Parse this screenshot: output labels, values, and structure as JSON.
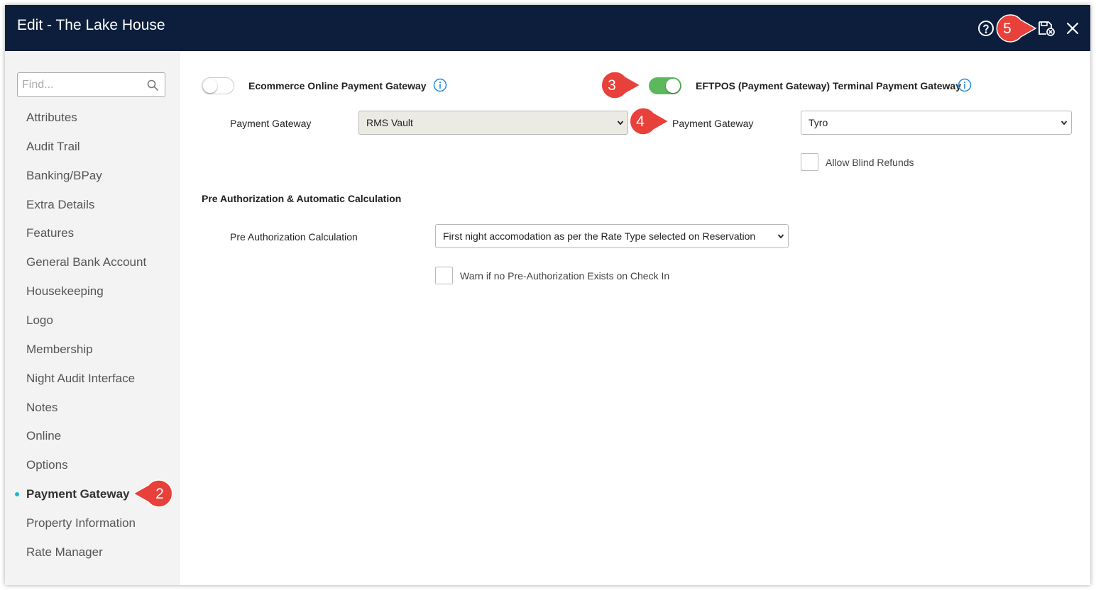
{
  "window": {
    "title": "Edit - The Lake House"
  },
  "header_icons": {
    "help": "help-icon",
    "save_close": "save-close-icon",
    "close": "close-icon"
  },
  "sidebar": {
    "search_placeholder": "Find...",
    "items": [
      {
        "label": "Attributes"
      },
      {
        "label": "Audit Trail"
      },
      {
        "label": "Banking/BPay"
      },
      {
        "label": "Extra Details"
      },
      {
        "label": "Features"
      },
      {
        "label": "General Bank Account"
      },
      {
        "label": "Housekeeping"
      },
      {
        "label": "Logo"
      },
      {
        "label": "Membership"
      },
      {
        "label": "Night Audit Interface"
      },
      {
        "label": "Notes"
      },
      {
        "label": "Online"
      },
      {
        "label": "Options"
      },
      {
        "label": "Payment Gateway"
      },
      {
        "label": "Property Information"
      },
      {
        "label": "Rate Manager"
      }
    ],
    "active_index": 13
  },
  "main": {
    "ecommerce": {
      "label": "Ecommerce Online Payment Gateway",
      "enabled": false,
      "gateway_label": "Payment Gateway",
      "gateway_value": "RMS Vault"
    },
    "eftpos": {
      "label": "EFTPOS (Payment Gateway) Terminal Payment Gateway",
      "enabled": true,
      "gateway_label": "Payment Gateway",
      "gateway_value": "Tyro",
      "blind_refunds_label": "Allow Blind Refunds",
      "blind_refunds_checked": false
    },
    "preauth": {
      "section_title": "Pre Authorization & Automatic Calculation",
      "calc_label": "Pre Authorization Calculation",
      "calc_value": "First night accomodation as per the Rate Type selected on Reservation",
      "warn_label": "Warn if no Pre-Authorization Exists on Check In",
      "warn_checked": false
    }
  },
  "callouts": [
    {
      "label": "2"
    },
    {
      "label": "3"
    },
    {
      "label": "4"
    },
    {
      "label": "5"
    }
  ],
  "colors": {
    "header_bg": "#0c1e3c",
    "toggle_on": "#5cb85c",
    "active_dot": "#1fb6d0",
    "callout": "#e8403a"
  }
}
